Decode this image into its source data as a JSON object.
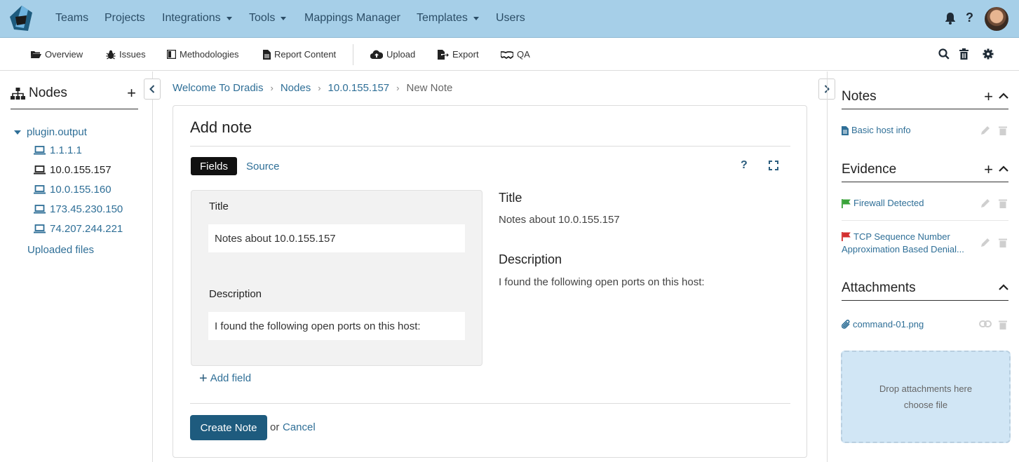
{
  "nav": {
    "items": [
      "Teams",
      "Projects",
      "Integrations",
      "Tools",
      "Mappings Manager",
      "Templates",
      "Users"
    ],
    "help_label": "?"
  },
  "toolbar": {
    "overview": "Overview",
    "issues": "Issues",
    "methodologies": "Methodologies",
    "report_content": "Report Content",
    "upload": "Upload",
    "export": "Export",
    "qa": "QA"
  },
  "left": {
    "title": "Nodes",
    "add_label": "+",
    "root": "plugin.output",
    "nodes": [
      "1.1.1.1",
      "10.0.155.157",
      "10.0.155.160",
      "173.45.230.150",
      "74.207.244.221"
    ],
    "uploaded": "Uploaded files"
  },
  "breadcrumb": [
    "Welcome To Dradis",
    "Nodes",
    "10.0.155.157",
    "New Note"
  ],
  "form": {
    "heading": "Add note",
    "tab_fields": "Fields",
    "tab_source": "Source",
    "help_label": "?",
    "title_label": "Title",
    "title_value": "Notes about 10.0.155.157",
    "desc_label": "Description",
    "desc_value": "I found the following open ports on this host:",
    "add_field": "Add field",
    "add_field_plus": "+",
    "submit": "Create Note",
    "or": "or",
    "cancel": "Cancel"
  },
  "preview": {
    "title_heading": "Title",
    "title_text": "Notes about 10.0.155.157",
    "desc_heading": "Description",
    "desc_text": "I found the following open ports on this host:"
  },
  "right": {
    "notes_title": "Notes",
    "notes_add": "+",
    "notes": [
      "Basic host info"
    ],
    "evidence_title": "Evidence",
    "evidence_add": "+",
    "evidence": [
      {
        "label": "Firewall Detected",
        "flag_color": "#3aa33a"
      },
      {
        "label": "TCP Sequence Number Approximation Based Denial...",
        "flag_color": "#d32f2f"
      }
    ],
    "attachments_title": "Attachments",
    "attachments": [
      "command-01.png"
    ],
    "drop_text": "Drop attachments here",
    "choose_file": "choose file"
  },
  "colors": {
    "nav_bg": "#a6cfe8",
    "link": "#2f6f97",
    "primary_button": "#1e5b7e",
    "dropzone": "#d1e6f5"
  }
}
